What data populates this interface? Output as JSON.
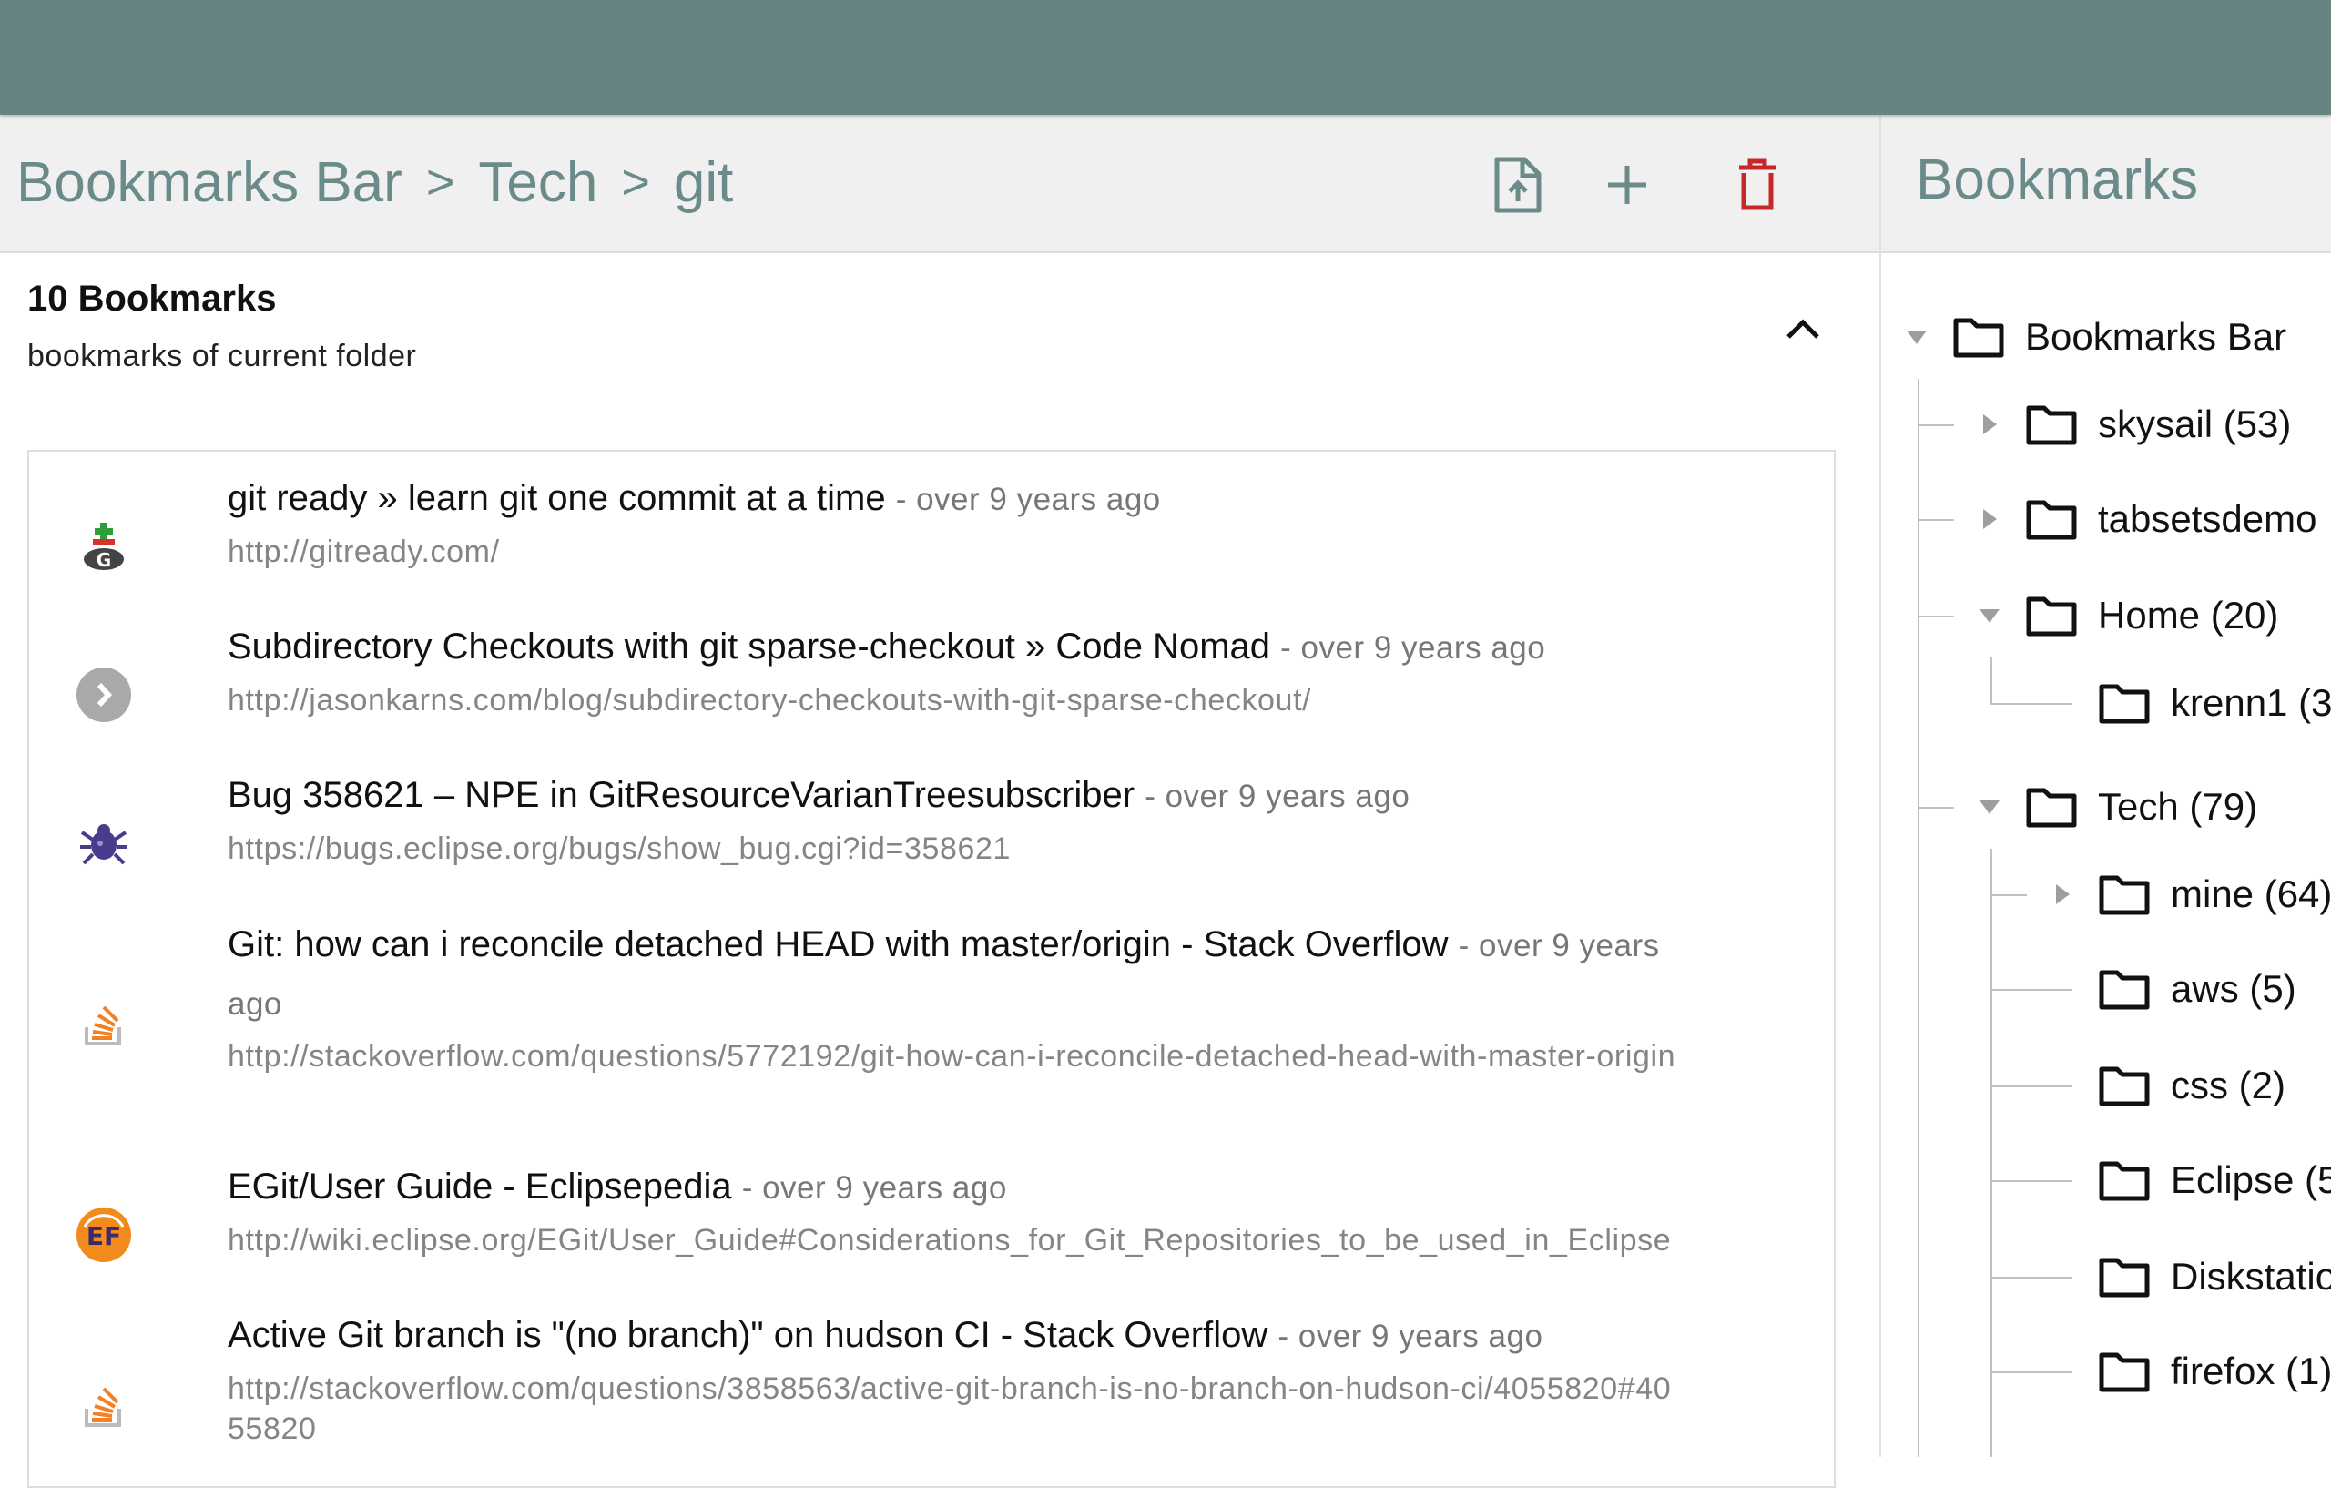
{
  "breadcrumb": [
    "Bookmarks Bar",
    "Tech",
    "git"
  ],
  "breadcrumb_separator": ">",
  "toolbar": {
    "export_icon": "file-upload-icon",
    "add_icon": "plus-icon",
    "delete_icon": "trash-icon",
    "icon_color": "#6a8b8a",
    "delete_color": "#c62828"
  },
  "summary": {
    "title": "10 Bookmarks",
    "subtitle": "bookmarks of current folder",
    "collapse_icon": "chevron-up-icon"
  },
  "bookmarks": [
    {
      "title": "git ready » learn git one commit at a time",
      "age": "- over 9 years ago",
      "url": "http://gitready.com/",
      "icon": "gitready-favicon"
    },
    {
      "title": "Subdirectory Checkouts with git sparse-checkout » Code Nomad",
      "age": "- over 9 years ago",
      "url": "http://jasonkarns.com/blog/subdirectory-checkouts-with-git-sparse-checkout/",
      "icon": "arrow-circle-favicon"
    },
    {
      "title": "Bug 358621 – NPE in GitResourceVarianTreesubscriber",
      "age": "- over 9 years ago",
      "url": "https://bugs.eclipse.org/bugs/show_bug.cgi?id=358621",
      "icon": "bugzilla-favicon"
    },
    {
      "title": "Git: how can i reconcile detached HEAD with master/origin - Stack Overflow",
      "age": "- over 9 years ago",
      "url": "http://stackoverflow.com/questions/5772192/git-how-can-i-reconcile-detached-head-with-master-origin",
      "icon": "stackoverflow-favicon"
    },
    {
      "title": "EGit/User Guide - Eclipsepedia",
      "age": "- over 9 years ago",
      "url": "http://wiki.eclipse.org/EGit/User_Guide#Considerations_for_Git_Repositories_to_be_used_in_Eclipse",
      "icon": "eclipsepedia-favicon",
      "icon_text": "EF"
    },
    {
      "title": "Active Git branch is \"(no branch)\" on hudson CI - Stack Overflow",
      "age": "- over 9 years ago",
      "url": "http://stackoverflow.com/questions/3858563/active-git-branch-is-no-branch-on-hudson-ci/4055820#4055820",
      "icon": "stackoverflow-favicon"
    }
  ],
  "sidebar": {
    "title": "Bookmarks",
    "tree": [
      {
        "label": "Bookmarks Bar",
        "toggle": "expanded"
      },
      {
        "label": "skysail (53)",
        "toggle": "collapsed"
      },
      {
        "label": "tabsetsdemo",
        "toggle": "collapsed"
      },
      {
        "label": "Home (20)",
        "toggle": "expanded"
      },
      {
        "label": "krenn1 (3",
        "toggle": "none"
      },
      {
        "label": "Tech (79)",
        "toggle": "expanded"
      },
      {
        "label": "mine (64)",
        "toggle": "collapsed"
      },
      {
        "label": "aws (5)",
        "toggle": "none"
      },
      {
        "label": "css (2)",
        "toggle": "none"
      },
      {
        "label": "Eclipse (5",
        "toggle": "none"
      },
      {
        "label": "Diskstatio",
        "toggle": "none"
      },
      {
        "label": "firefox (1)",
        "toggle": "none"
      }
    ]
  },
  "colors": {
    "header_bg": "#668582",
    "accent_text": "#6a8b8a",
    "toolbar_bg": "#f0f0f0",
    "muted_text": "#858585"
  }
}
